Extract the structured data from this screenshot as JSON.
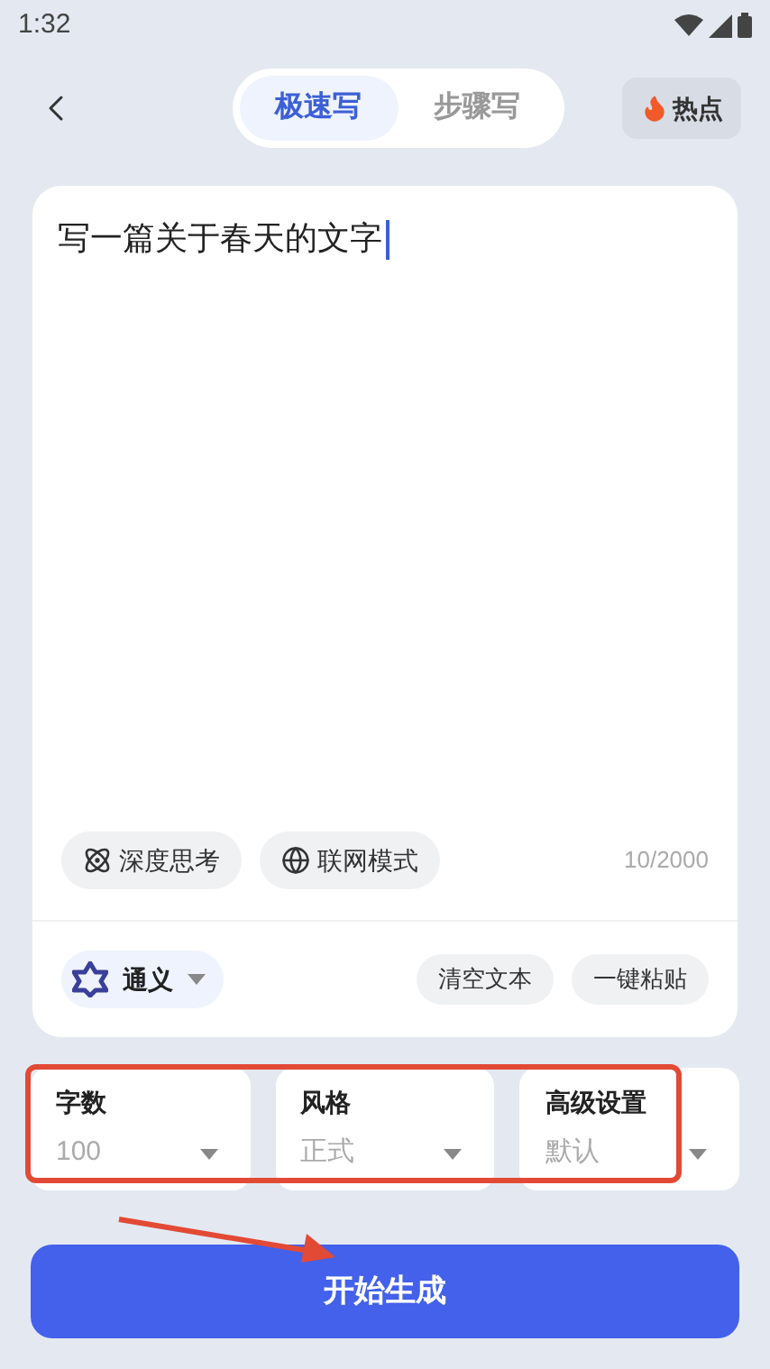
{
  "status_bar": {
    "time": "1:32"
  },
  "mode_tabs": [
    {
      "label": "极速写",
      "selected": true
    },
    {
      "label": "步骤写",
      "selected": false
    }
  ],
  "hot_button": {
    "label": "热点"
  },
  "editor": {
    "value": "写一篇关于春天的文字",
    "counter": "10/2000"
  },
  "toggles": [
    {
      "label": "深度思考",
      "kind": "think",
      "on": false
    },
    {
      "label": "联网模式",
      "kind": "web",
      "on": false
    }
  ],
  "model_selector": {
    "label": "通义"
  },
  "actions": [
    "清空文本",
    "一键粘贴"
  ],
  "settings": [
    {
      "label": "字数",
      "value": "100"
    },
    {
      "label": "风格",
      "value": "正式"
    },
    {
      "label": "高级设置",
      "value": "默认"
    }
  ],
  "submit_button": {
    "label": "开始生成"
  }
}
